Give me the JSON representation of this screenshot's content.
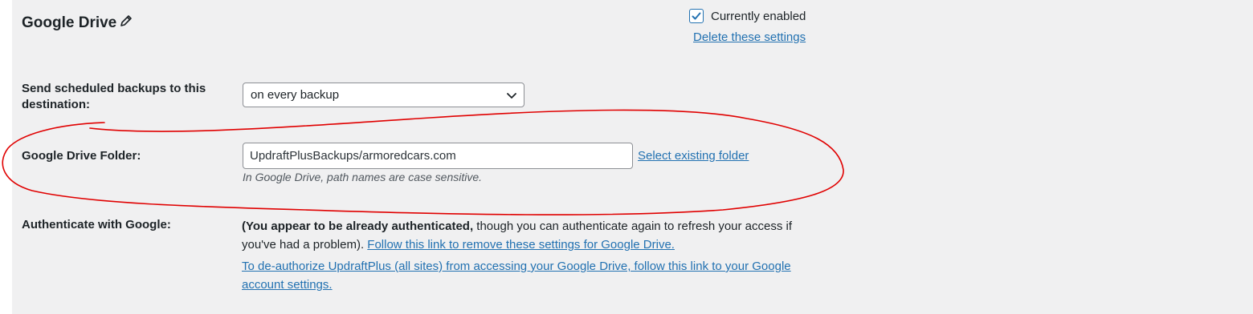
{
  "section": {
    "title": "Google Drive",
    "icon": "pencil-icon"
  },
  "enabled": {
    "checked": true,
    "label": "Currently enabled"
  },
  "delete_link": "Delete these settings",
  "schedule": {
    "label": "Send scheduled backups to this destination:",
    "selected": "on every backup"
  },
  "folder": {
    "label": "Google Drive Folder:",
    "value": "UpdraftPlusBackups/armoredcars.com",
    "select_link": "Select existing folder",
    "hint": "In Google Drive, path names are case sensitive."
  },
  "auth": {
    "label": "Authenticate with Google:",
    "bold_text": "(You appear to be already authenticated,",
    "text": " though you can authenticate again to refresh your access if you've had a problem).",
    "remove_link": "Follow this link to remove these settings for Google Drive.",
    "deauth_link": "To de-authorize UpdraftPlus (all sites) from accessing your Google Drive, follow this link to your Google account settings."
  },
  "colors": {
    "link": "#2271b1",
    "panel": "#f0f0f1",
    "annotation": "#e00000"
  }
}
